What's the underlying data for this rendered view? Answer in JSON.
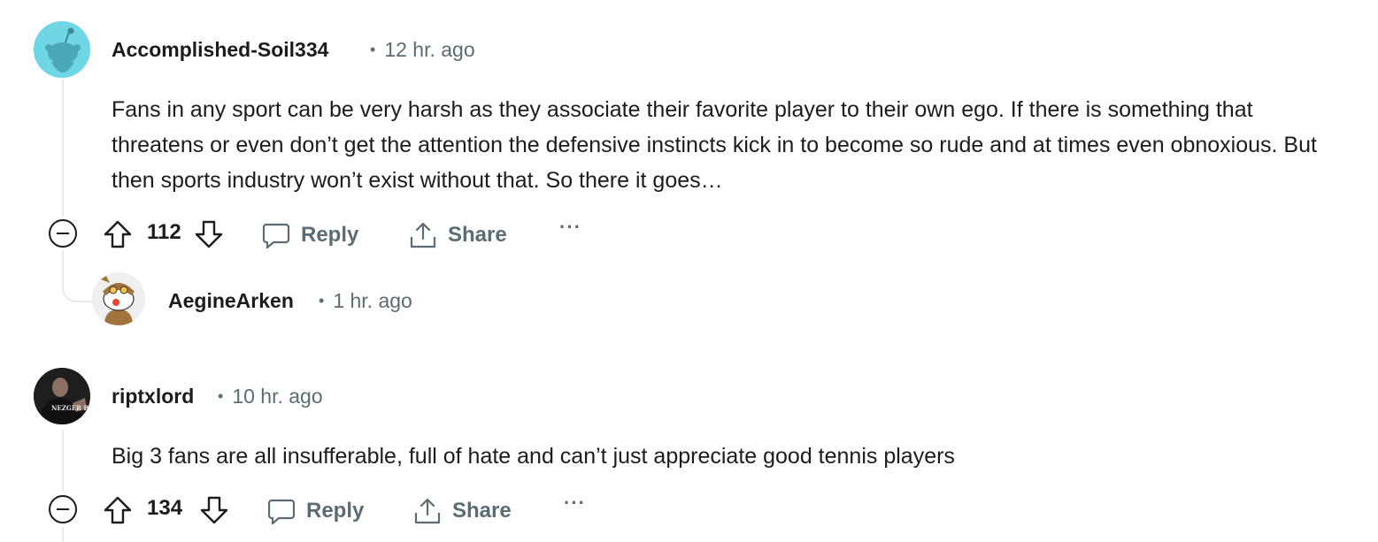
{
  "comments": [
    {
      "author": "Accomplished-Soil334",
      "time": "12 hr. ago",
      "body": "Fans in any sport can be very harsh as they associate their favorite player to their own ego. If there is something that threatens or even don’t get the attention the defensive instincts kick in to become so rude and at times even obnoxious. But then sports industry won’t exist without that. So there it goes…",
      "score": "112",
      "avatar_icon": "reddit-snoo-default-avatar",
      "avatar_color": "#6fd6e6",
      "reply": {
        "author": "AegineArken",
        "time": "1 hr. ago",
        "avatar_icon": "reddit-snoo-custom-avatar"
      }
    },
    {
      "author": "riptxlord",
      "time": "10 hr. ago",
      "body": "Big 3 fans are all insufferable, full of hate and can’t just appreciate good tennis players",
      "score": "134",
      "avatar_icon": "user-photo-avatar",
      "avatar_text": "NEZGER BITCH"
    }
  ],
  "actions": {
    "reply_label": "Reply",
    "share_label": "Share",
    "more_label": "···"
  },
  "meta_separator": "•",
  "colors": {
    "text": "#1c1c1c",
    "meta": "#5c6c74",
    "thread_line": "#e5ebee"
  }
}
